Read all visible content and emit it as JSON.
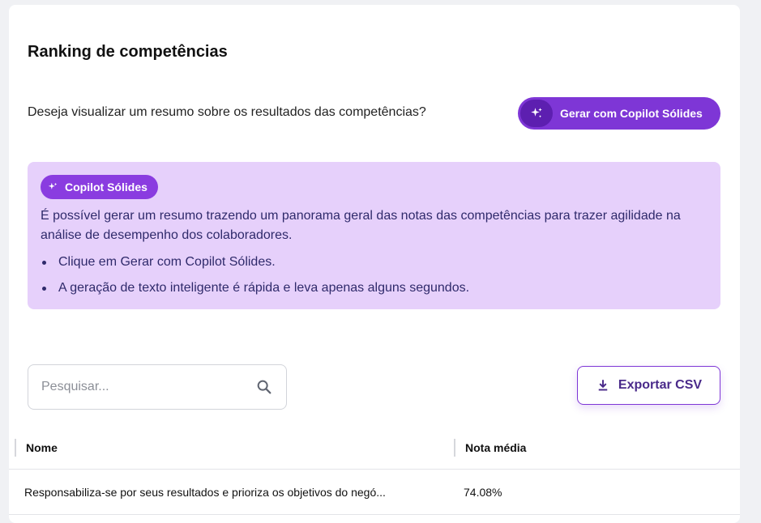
{
  "page": {
    "title": "Ranking de competências",
    "question": "Deseja visualizar um resumo sobre os resultados das competências?"
  },
  "generate_button": {
    "label": "Gerar com Copilot Sólides",
    "icon": "sparkles-icon"
  },
  "info_box": {
    "badge": "Copilot Sólides",
    "text": "É possível gerar um resumo trazendo um panorama geral das notas das competências para trazer agilidade na análise de desempenho dos colaboradores.",
    "bullets": [
      "Clique em Gerar com Copilot Sólides.",
      "A geração de texto inteligente é rápida e leva apenas alguns segundos."
    ]
  },
  "search": {
    "placeholder": "Pesquisar...",
    "value": "",
    "icon": "search-icon"
  },
  "export_button": {
    "label": "Exportar CSV",
    "icon": "download-icon"
  },
  "table": {
    "columns": [
      "Nome",
      "Nota média"
    ],
    "rows": [
      {
        "name": "Responsabiliza-se por seus resultados e prioriza os objetivos do negó...",
        "score": "74.08%"
      }
    ]
  },
  "colors": {
    "accent": "#7e36d6",
    "info_bg": "#e6d0fb",
    "text_dark": "#2f2a6b"
  }
}
